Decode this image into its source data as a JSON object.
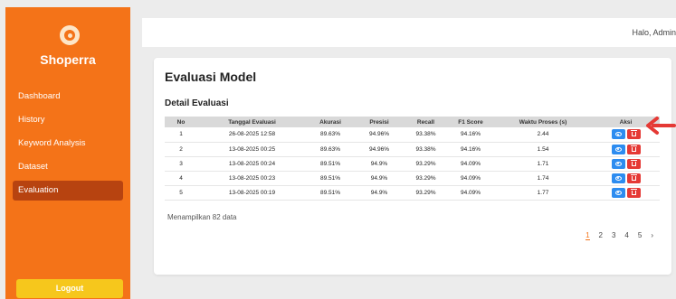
{
  "sidebar": {
    "brand": "Shoperra",
    "items": [
      {
        "label": "Dashboard"
      },
      {
        "label": "History"
      },
      {
        "label": "Keyword Analysis"
      },
      {
        "label": "Dataset"
      },
      {
        "label": "Evaluation",
        "active": true
      }
    ],
    "logout": "Logout"
  },
  "header": {
    "greeting": "Halo, Admin"
  },
  "main": {
    "title": "Evaluasi Model",
    "subtitle": "Detail Evaluasi",
    "table": {
      "headers": [
        "No",
        "Tanggal Evaluasi",
        "Akurasi",
        "Presisi",
        "Recall",
        "F1 Score",
        "Waktu Proses (s)",
        "Aksi"
      ],
      "rows": [
        [
          "1",
          "26-08-2025 12:58",
          "89.63%",
          "94.96%",
          "93.38%",
          "94.16%",
          "2.44"
        ],
        [
          "2",
          "13-08-2025 00:25",
          "89.63%",
          "94.96%",
          "93.38%",
          "94.16%",
          "1.54"
        ],
        [
          "3",
          "13-08-2025 00:24",
          "89.51%",
          "94.9%",
          "93.29%",
          "94.09%",
          "1.71"
        ],
        [
          "4",
          "13-08-2025 00:23",
          "89.51%",
          "94.9%",
          "93.29%",
          "94.09%",
          "1.74"
        ],
        [
          "5",
          "13-08-2025 00:19",
          "89.51%",
          "94.9%",
          "93.29%",
          "94.09%",
          "1.77"
        ]
      ]
    },
    "count_text": "Menampilkan 82 data",
    "pagination": [
      "1",
      "2",
      "3",
      "4",
      "5",
      "›"
    ],
    "current_page": "1"
  },
  "icons": {
    "view": "eye-icon",
    "delete": "trash-icon",
    "logo": "logo-icon",
    "annotation": "red-arrow-icon"
  },
  "colors": {
    "sidebar": "#f47318",
    "sidebar_active": "#b74310",
    "logout": "#f6c71c",
    "view_button": "#2d8cf0",
    "delete_button": "#e53935",
    "annotation_arrow": "#e53935"
  }
}
